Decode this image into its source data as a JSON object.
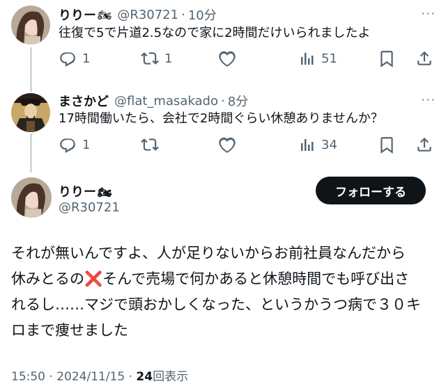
{
  "reply1": {
    "name": "りりー",
    "handle": "@R30721",
    "time": "10分",
    "text": "往復で5で片道2.5なので家に2時間だけいられましたよ",
    "counts": {
      "reply": "1",
      "repost": "1",
      "like": "",
      "views": "51"
    }
  },
  "reply2": {
    "name": "まさかど",
    "handle": "@flat_masakado",
    "time": "8分",
    "text": "17時間働いたら、会社で2時間ぐらい休憩ありませんか？",
    "counts": {
      "reply": "1",
      "repost": "",
      "like": "",
      "views": "34"
    }
  },
  "main": {
    "name": "りりー",
    "handle": "@R30721",
    "follow_label": "フォローする",
    "text_line1": "それが無いんですよ、人が足りないからお前社員なんだから",
    "text_line2a": "休みとるの",
    "text_line2b": "そんで売場で何かあると休憩時間でも呼び出さ",
    "text_line3": "れるし……マジで頭おかしくなった、というかうつ病で３０キ",
    "text_line4": "ロまで痩せました",
    "timestamp": "15:50 · 2024/11/15 · ",
    "views_count": "24",
    "views_label": "回表示"
  },
  "symbols": {
    "separator": "·",
    "more": "···",
    "x_mark": "❌",
    "motorcycle": "🏍"
  },
  "icons": [
    "reply-icon",
    "repost-icon",
    "like-icon",
    "views-icon",
    "bookmark-icon",
    "share-icon",
    "more-icon",
    "motorcycle-icon",
    "cross-mark-icon"
  ],
  "colors": {
    "text": "#0f1419",
    "secondary": "#536471",
    "thread_line": "#cfd9de",
    "follow_bg": "#0f1419",
    "cross": "#dd2e44"
  }
}
